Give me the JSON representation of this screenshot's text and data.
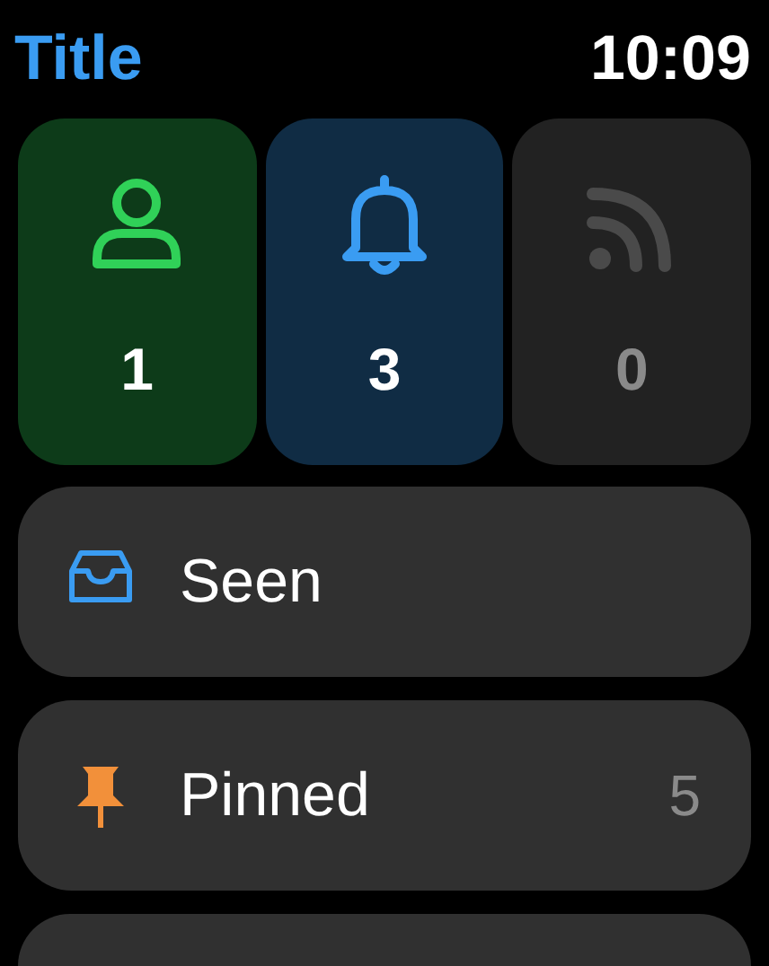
{
  "header": {
    "title": "Title",
    "time": "10:09"
  },
  "tiles": [
    {
      "kind": "person",
      "color": "#30d158",
      "count": "1",
      "active": true
    },
    {
      "kind": "bell",
      "color": "#3a9cf2",
      "count": "3",
      "active": true
    },
    {
      "kind": "feed",
      "color": "#4a4a4a",
      "count": "0",
      "active": false
    }
  ],
  "rows": [
    {
      "kind": "tray",
      "color": "#3a9cf2",
      "label": "Seen"
    },
    {
      "kind": "pin",
      "color": "#f2903a",
      "label": "Pinned",
      "count": "5"
    },
    {
      "kind": "cut"
    }
  ]
}
